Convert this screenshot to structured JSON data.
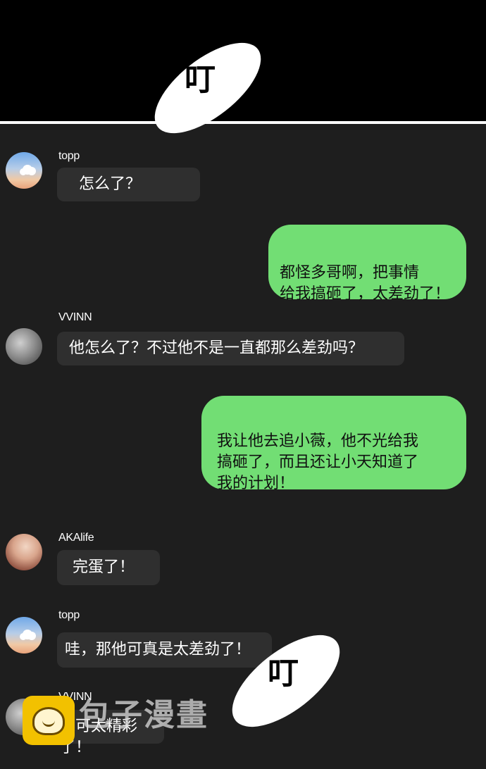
{
  "sound_effects": [
    "叮",
    "叮"
  ],
  "messages": [
    {
      "sender": "topp",
      "text": "怎么了？"
    },
    {
      "sender": "me",
      "text": "都怪多哥啊，把事情\n给我搞砸了，太差劲了！"
    },
    {
      "sender": "VVINN",
      "text": "他怎么了？不过他不是一直都那么差劲吗？"
    },
    {
      "sender": "me",
      "text": "我让他去追小薇，他不光给我\n搞砸了，而且还让小天知道了\n我的计划！"
    },
    {
      "sender": "AKAlife",
      "text": "完蛋了！"
    },
    {
      "sender": "topp",
      "text": "哇，那他可真是太差劲了！"
    },
    {
      "sender": "VVINN",
      "text": "这可太精彩了！"
    }
  ],
  "watermark": {
    "text": "包子漫畫"
  },
  "colors": {
    "background": "#1e1e1e",
    "incoming_bubble": "#2f2f2f",
    "outgoing_bubble": "#72de74"
  }
}
